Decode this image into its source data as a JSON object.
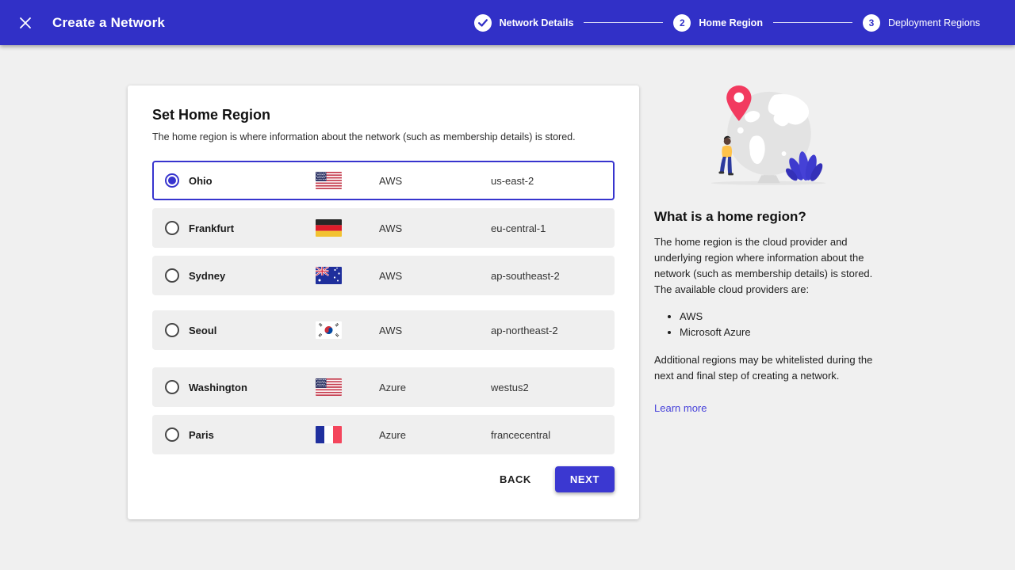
{
  "header": {
    "title": "Create a Network",
    "steps": [
      {
        "label": "Network Details",
        "state": "complete",
        "indicator": "check"
      },
      {
        "label": "Home Region",
        "state": "active",
        "indicator": "2"
      },
      {
        "label": "Deployment Regions",
        "state": "upcoming",
        "indicator": "3"
      }
    ]
  },
  "card": {
    "title": "Set Home Region",
    "subtitle": "The home region is where information about the network (such as membership details) is stored.",
    "regions": [
      {
        "name": "Ohio",
        "flag": "us",
        "provider": "AWS",
        "code": "us-east-2",
        "selected": true
      },
      {
        "name": "Frankfurt",
        "flag": "de",
        "provider": "AWS",
        "code": "eu-central-1",
        "selected": false
      },
      {
        "name": "Sydney",
        "flag": "au",
        "provider": "AWS",
        "code": "ap-southeast-2",
        "selected": false
      },
      {
        "name": "Seoul",
        "flag": "kr",
        "provider": "AWS",
        "code": "ap-northeast-2",
        "selected": false
      },
      {
        "name": "Washington",
        "flag": "us",
        "provider": "Azure",
        "code": "westus2",
        "selected": false
      },
      {
        "name": "Paris",
        "flag": "fr",
        "provider": "Azure",
        "code": "francecentral",
        "selected": false
      }
    ],
    "back_label": "BACK",
    "next_label": "NEXT"
  },
  "sidebar": {
    "heading": "What is a home region?",
    "body": "The home region is the cloud provider and underlying region where information about the network (such as membership details) is stored. The available cloud providers are:",
    "bullets": [
      "AWS",
      "Microsoft Azure"
    ],
    "note": "Additional regions may be whitelisted during the next and final step of creating a network.",
    "link_label": "Learn more"
  },
  "colors": {
    "header_bg": "#3130c7",
    "accent": "#3734ce",
    "button": "#3b38d1",
    "page_bg": "#f0f0f0",
    "row_bg": "#efefef",
    "link": "#4742da",
    "pin": "#f23a5f"
  }
}
